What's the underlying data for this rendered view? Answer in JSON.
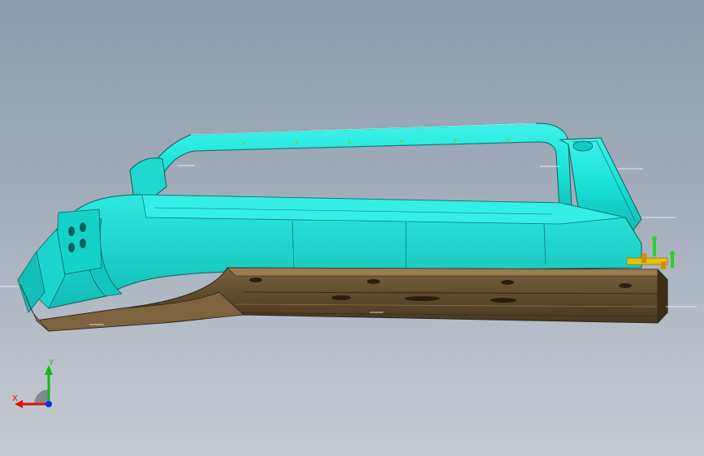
{
  "viewport": {
    "background_top": "#8e9bad",
    "background_bottom": "#c8ccd3"
  },
  "model": {
    "part_color": "#18e0d6",
    "part_shade": "#0fb5b0",
    "part_edge": "#0a5f5c",
    "base_color": "#6b5433",
    "base_shade": "#4d3b22",
    "base_highlight": "#8a6e48",
    "fastener_color": "#e6c200",
    "fastener_alt": "#2bd12b"
  },
  "triad": {
    "x_label": "X",
    "y_label": "Y",
    "x_color": "#e01010",
    "y_color": "#10b810",
    "z_color": "#1030e0"
  }
}
